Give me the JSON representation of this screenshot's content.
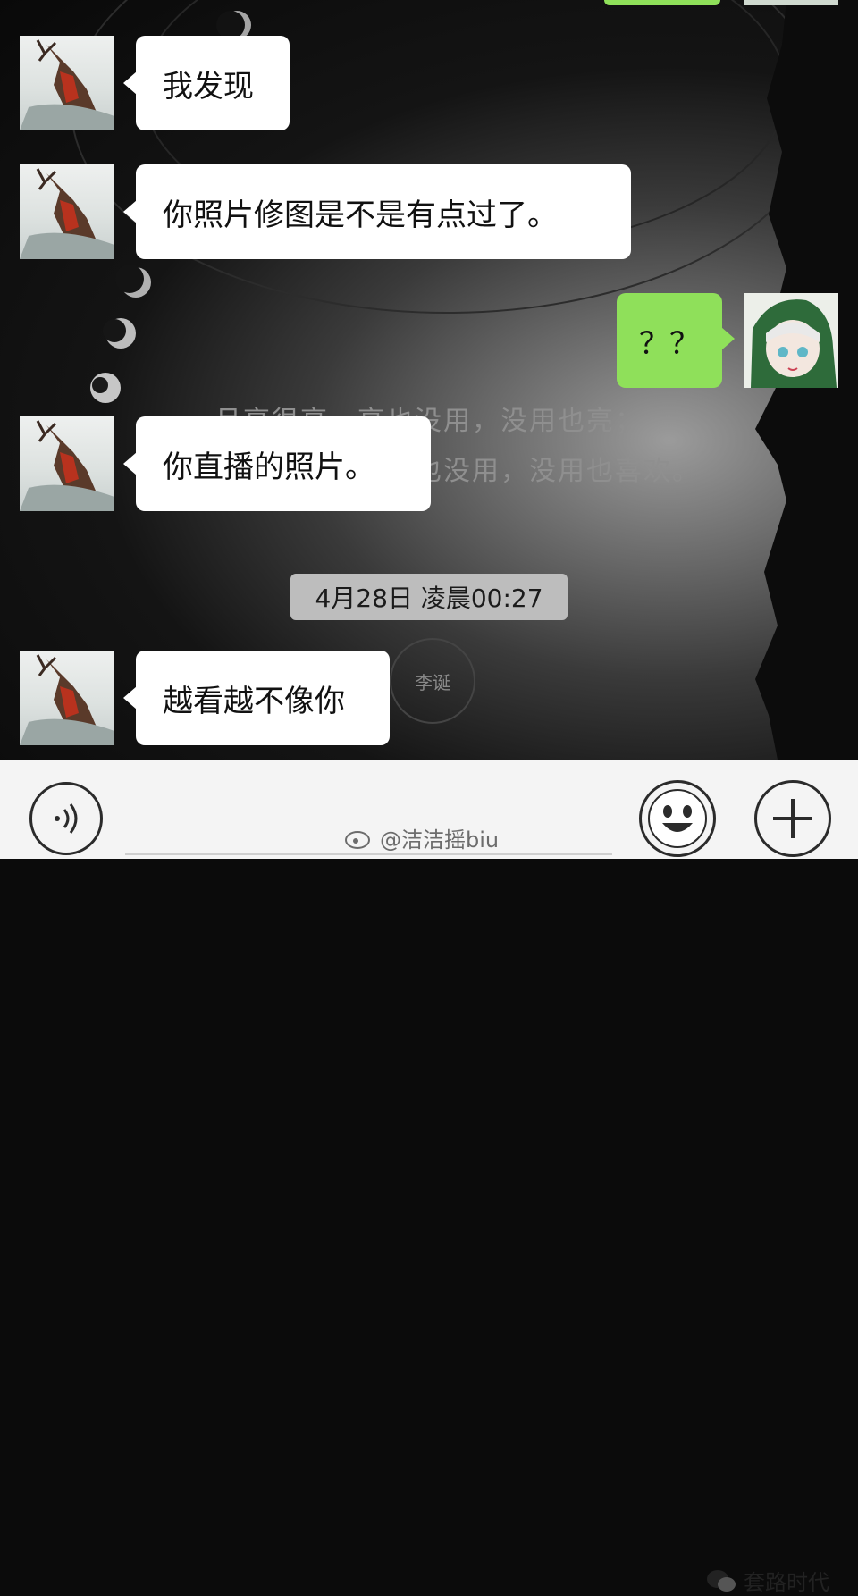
{
  "poem": {
    "line1": "月亮很亮，亮也没用，没用也亮；",
    "line2": "我喜欢你，喜欢也没用，没用也喜欢。"
  },
  "messages": [
    {
      "side": "left",
      "text": "我发现"
    },
    {
      "side": "left",
      "text": "你照片修图是不是有点过了。"
    },
    {
      "side": "right",
      "text": "？？"
    },
    {
      "side": "left",
      "text": "你直播的照片。"
    },
    {
      "side": "left",
      "text": "越看越不像你"
    }
  ],
  "timestamp": "4月28日 凌晨00:27",
  "wallpaper_stamp": "李诞",
  "bottom_bar": {
    "voice_icon": "voice-icon",
    "emoji_icon": "emoji-icon",
    "plus_icon": "plus-icon"
  },
  "watermarks": {
    "credit_text": "@洁洁摇biu",
    "brand_text": "套路时代"
  },
  "colors": {
    "sent_bubble": "#8fe05a",
    "received_bubble": "#ffffff",
    "timestamp_bg": "#bdbdbd"
  }
}
